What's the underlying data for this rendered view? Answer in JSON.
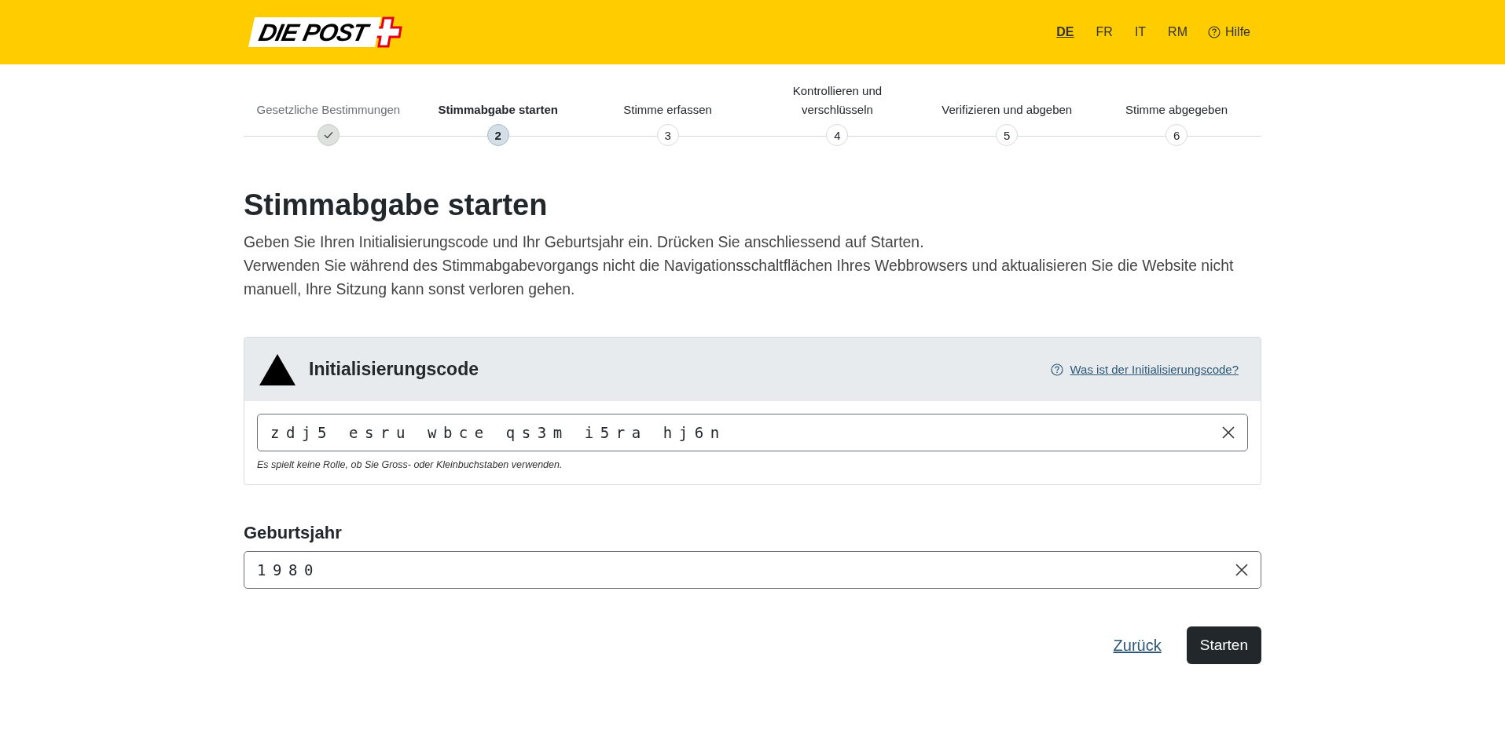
{
  "header": {
    "logo_text": "DIE POST",
    "languages": [
      {
        "label": "DE",
        "selected": true
      },
      {
        "label": "FR",
        "selected": false
      },
      {
        "label": "IT",
        "selected": false
      },
      {
        "label": "RM",
        "selected": false
      }
    ],
    "help": "Hilfe"
  },
  "steps": [
    {
      "label": "Gesetzliche Bestimmungen",
      "done": true,
      "selected": false
    },
    {
      "label": "Stimmabgabe starten",
      "number": "2",
      "done": false,
      "selected": true
    },
    {
      "label": "Stimme erfassen",
      "number": "3",
      "done": false,
      "selected": false
    },
    {
      "label": "Kontrollieren und verschlüsseln",
      "number": "4",
      "done": false,
      "selected": false
    },
    {
      "label": "Verifizieren und abgeben",
      "number": "5",
      "done": false,
      "selected": false
    },
    {
      "label": "Stimme abgegeben",
      "number": "6",
      "done": false,
      "selected": false
    }
  ],
  "title": "Stimmabgabe starten",
  "intro": [
    "Geben Sie Ihren Initialisierungscode und Ihr Geburtsjahr ein. Drücken Sie anschliessend auf Starten.",
    "Verwenden Sie während des Stimmabgabevorgangs nicht die Navigationsschaltflächen Ihres Webbrowsers und aktualisieren Sie die Website nicht manuell, Ihre Sitzung kann sonst verloren gehen."
  ],
  "code_card": {
    "title": "Initialisierungscode",
    "help_link": "Was ist der Initialisierungscode?",
    "value": "zdj5 esru wbce qs3m i5ra hj6n",
    "hint": "Es spielt keine Rolle, ob Sie Gross- oder Kleinbuchstaben verwenden."
  },
  "birth_year": {
    "label": "Geburtsjahr",
    "value": "1980"
  },
  "buttons": {
    "back": "Zurück",
    "start": "Starten"
  }
}
